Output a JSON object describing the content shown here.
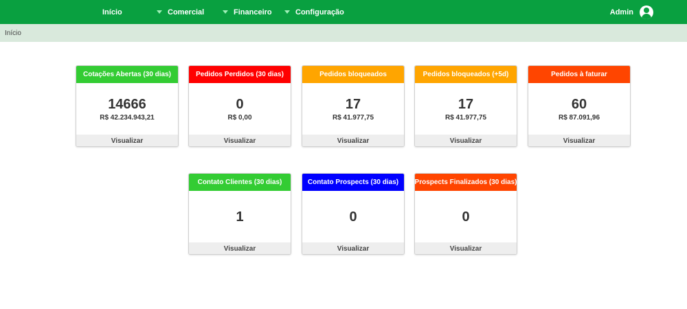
{
  "nav": {
    "home": "Início",
    "commercial": "Comercial",
    "financial": "Financeiro",
    "settings": "Configuração",
    "user": "Admin"
  },
  "breadcrumb": "Início",
  "colors": {
    "topbar": "#09a040",
    "green": "#33cc33",
    "red": "#ff0000",
    "orange": "#ffa500",
    "orange_red": "#ff4500",
    "blue": "#0000ff"
  },
  "cards_row1": [
    {
      "title": "Cotações Abertas (30 dias)",
      "count": "14666",
      "amount": "R$ 42.234.943,21",
      "action": "Visualizar",
      "color": "#33cc33"
    },
    {
      "title": "Pedidos Perdidos (30 dias)",
      "count": "0",
      "amount": "R$ 0,00",
      "action": "Visualizar",
      "color": "#ff0000"
    },
    {
      "title": "Pedidos bloqueados",
      "count": "17",
      "amount": "R$ 41.977,75",
      "action": "Visualizar",
      "color": "#ffa500"
    },
    {
      "title": "Pedidos bloqueados (+5d)",
      "count": "17",
      "amount": "R$ 41.977,75",
      "action": "Visualizar",
      "color": "#ffa500"
    },
    {
      "title": "Pedidos à faturar",
      "count": "60",
      "amount": "R$ 87.091,96",
      "action": "Visualizar",
      "color": "#ff4500"
    }
  ],
  "cards_row2": [
    {
      "title": "Contato Clientes (30 dias)",
      "count": "1",
      "action": "Visualizar",
      "color": "#33cc33"
    },
    {
      "title": "Contato Prospects (30 dias)",
      "count": "0",
      "action": "Visualizar",
      "color": "#0000ff"
    },
    {
      "title": "Prospects Finalizados (30 dias)",
      "count": "0",
      "action": "Visualizar",
      "color": "#ff4500"
    }
  ]
}
